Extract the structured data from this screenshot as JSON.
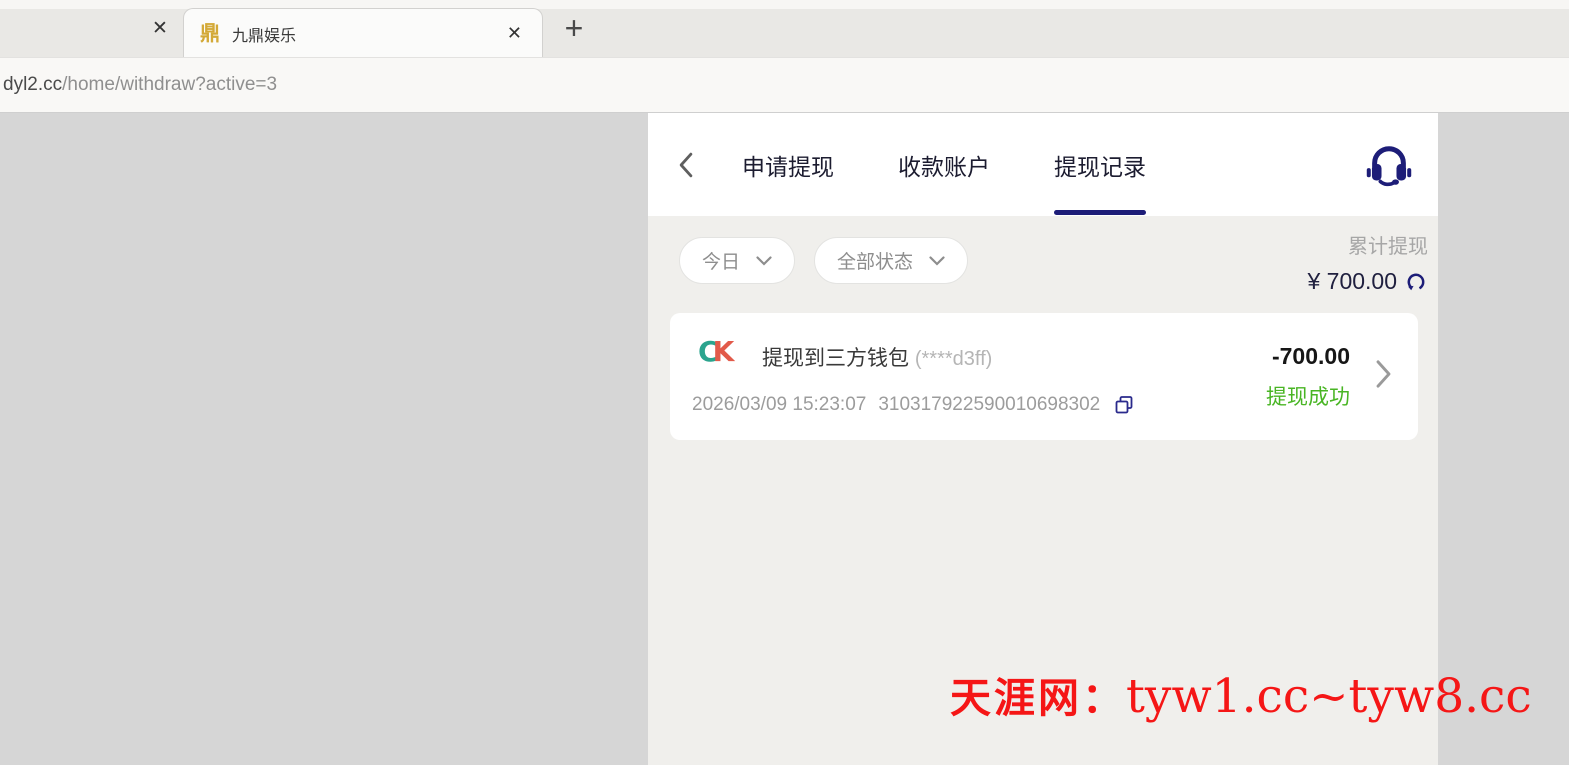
{
  "browser": {
    "partial_tab": {
      "close_label": "✕"
    },
    "active_tab": {
      "favicon_glyph": "鼎",
      "title": "九鼎娱乐",
      "close_label": "✕"
    },
    "new_tab_label": "+",
    "url": {
      "host": "dyl2.cc",
      "path": "/home/withdraw?active=3"
    }
  },
  "panel": {
    "nav_tabs": [
      {
        "label": "申请提现"
      },
      {
        "label": "收款账户"
      },
      {
        "label": "提现记录"
      }
    ],
    "active_tab_index": 2,
    "icons": {
      "back": "back-chevron",
      "headset": "customer-service-headset",
      "refresh": "refresh-circular-arrow",
      "copy": "copy-overlapping-squares"
    },
    "filters": {
      "date": "今日",
      "status": "全部状态"
    },
    "summary": {
      "label": "累计提现",
      "amount": "¥ 700.00"
    },
    "record": {
      "logo_c": "C",
      "logo_k": "K",
      "title": "提现到三方钱包",
      "account_masked": "(****d3ff)",
      "datetime": "2026/03/09 15:23:07",
      "order_id": "310317922590010698302",
      "amount": "-700.00",
      "status": "提现成功"
    }
  },
  "watermark": {
    "site_name": "天涯网：",
    "urls": "tyw1.cc~tyw8.cc"
  },
  "colors": {
    "accent_navy": "#1d1d78",
    "success_green": "#49b524",
    "watermark_red": "#f51616",
    "logo_teal": "#2ba48e",
    "logo_coral": "#e25a4a"
  }
}
